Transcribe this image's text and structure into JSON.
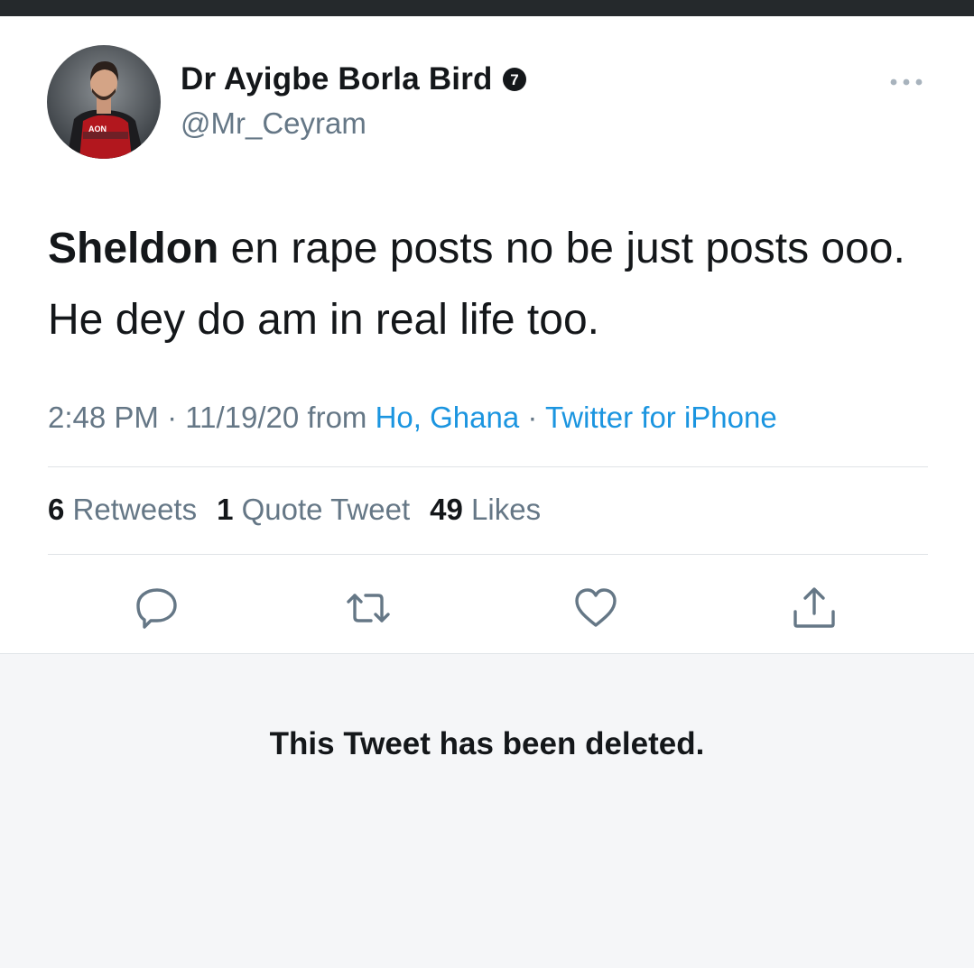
{
  "user": {
    "display_name": "Dr Ayigbe Borla Bird",
    "badge_number": "7",
    "handle": "@Mr_Ceyram",
    "avatar_shirt_text": "AON"
  },
  "tweet": {
    "mention": "Sheldon",
    "text": " en rape posts no be just posts ooo. He dey do am in real life too.",
    "time": "2:48 PM",
    "separator": " · ",
    "date": "11/19/20",
    "from_label": " from ",
    "location": "Ho, Ghana",
    "source": "Twitter for iPhone"
  },
  "stats": {
    "retweets_count": "6",
    "retweets_label": "Retweets",
    "quotes_count": "1",
    "quotes_label": "Quote Tweet",
    "likes_count": "49",
    "likes_label": "Likes"
  },
  "actions": [
    "reply-icon",
    "retweet-icon",
    "like-icon",
    "share-icon"
  ],
  "deleted_notice": "This Tweet has been deleted.",
  "colors": {
    "text": "#14171a",
    "secondary": "#657786",
    "link": "#1b95e0",
    "topbar": "#25292c",
    "deleted_bg": "#f5f6f8"
  }
}
